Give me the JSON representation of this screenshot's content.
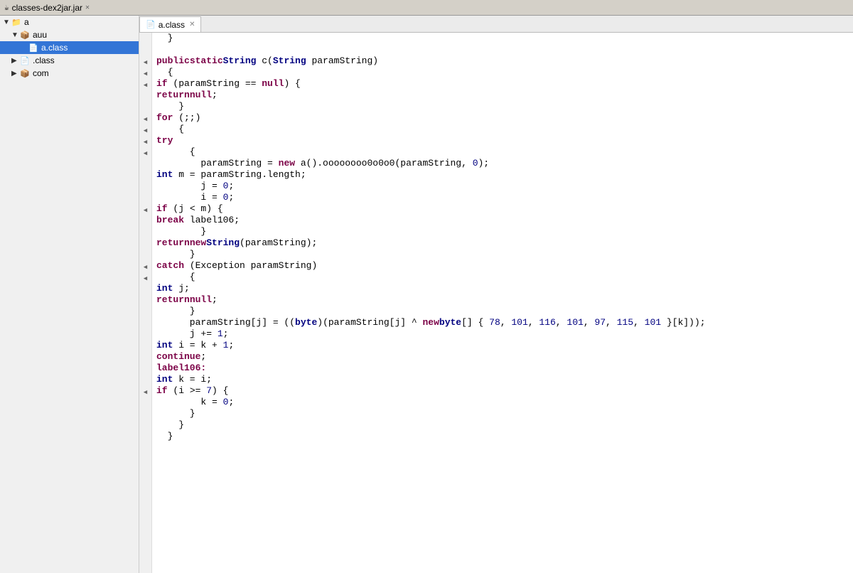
{
  "titleBar": {
    "label": "classes-dex2jar.jar",
    "closeSymbol": "✕"
  },
  "sidebar": {
    "items": [
      {
        "id": "a",
        "label": "a",
        "level": 0,
        "type": "folder",
        "expanded": true,
        "arrow": "▼"
      },
      {
        "id": "auu",
        "label": "auu",
        "level": 1,
        "type": "package",
        "expanded": true,
        "arrow": "▼"
      },
      {
        "id": "a.class",
        "label": "a.class",
        "level": 2,
        "type": "class",
        "expanded": false,
        "arrow": "",
        "selected": true
      },
      {
        "id": ".class",
        "label": ".class",
        "level": 1,
        "type": "class-folder",
        "expanded": false,
        "arrow": "▶"
      },
      {
        "id": "com",
        "label": "com",
        "level": 1,
        "type": "package",
        "expanded": false,
        "arrow": "▶"
      }
    ]
  },
  "tab": {
    "label": "a.class",
    "closeSymbol": "✕"
  },
  "code": {
    "lines": [
      {
        "gutter": "",
        "text": "  }"
      },
      {
        "gutter": "",
        "text": ""
      },
      {
        "gutter": "◀",
        "text": "  public static String c(String paramString)"
      },
      {
        "gutter": "◀",
        "text": "  {"
      },
      {
        "gutter": "◀",
        "text": "    if (paramString == null) {"
      },
      {
        "gutter": "",
        "text": "      return null;"
      },
      {
        "gutter": "",
        "text": "    }"
      },
      {
        "gutter": "◀",
        "text": "    for (;;)"
      },
      {
        "gutter": "◀",
        "text": "    {"
      },
      {
        "gutter": "◀",
        "text": "      try"
      },
      {
        "gutter": "◀",
        "text": "      {"
      },
      {
        "gutter": "",
        "text": "        paramString = new a().oooooooo0o0o0(paramString, 0);"
      },
      {
        "gutter": "",
        "text": "        int m = paramString.length;"
      },
      {
        "gutter": "",
        "text": "        j = 0;"
      },
      {
        "gutter": "",
        "text": "        i = 0;"
      },
      {
        "gutter": "◀",
        "text": "        if (j < m) {"
      },
      {
        "gutter": "",
        "text": "          break label106;"
      },
      {
        "gutter": "",
        "text": "        }"
      },
      {
        "gutter": "",
        "text": "        return new String(paramString);"
      },
      {
        "gutter": "",
        "text": "      }"
      },
      {
        "gutter": "◀",
        "text": "      catch (Exception paramString)"
      },
      {
        "gutter": "◀",
        "text": "      {"
      },
      {
        "gutter": "",
        "text": "        int j;"
      },
      {
        "gutter": "",
        "text": "        return null;"
      },
      {
        "gutter": "",
        "text": "      }"
      },
      {
        "gutter": "",
        "text": "      paramString[j] = ((byte)(paramString[j] ^ new byte[] { 78, 101, 116, 101, 97, 115, 101 }[k]));"
      },
      {
        "gutter": "",
        "text": "      j += 1;"
      },
      {
        "gutter": "",
        "text": "      int i = k + 1;"
      },
      {
        "gutter": "",
        "text": "      continue;"
      },
      {
        "gutter": "",
        "text": "      label106:"
      },
      {
        "gutter": "",
        "text": "      int k = i;"
      },
      {
        "gutter": "◀",
        "text": "      if (i >= 7) {"
      },
      {
        "gutter": "",
        "text": "        k = 0;"
      },
      {
        "gutter": "",
        "text": "      }"
      },
      {
        "gutter": "",
        "text": "    }"
      },
      {
        "gutter": "",
        "text": "  }"
      }
    ]
  }
}
